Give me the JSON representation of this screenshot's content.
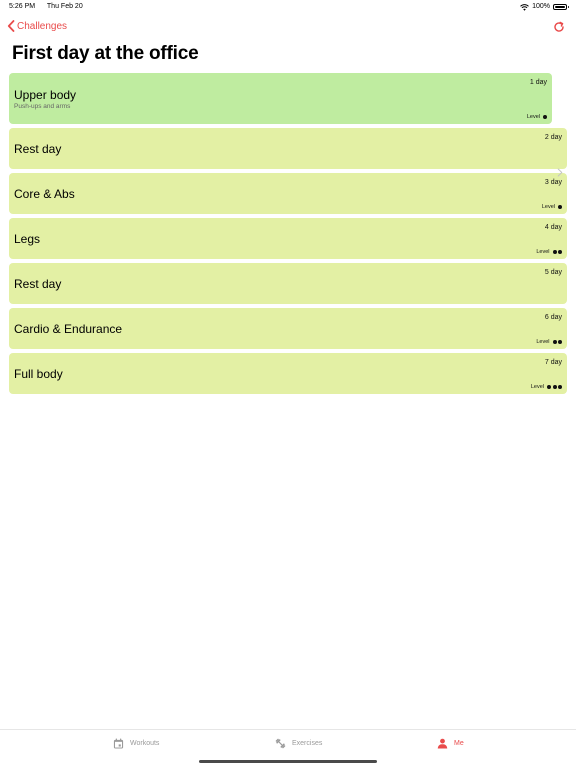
{
  "status_bar": {
    "time": "5:26 PM",
    "date": "Thu Feb 20",
    "battery": "100%"
  },
  "nav": {
    "back_label": "Challenges",
    "accent_color": "#e94b4b"
  },
  "page": {
    "title": "First day at the office"
  },
  "days": [
    {
      "name": "Upper body",
      "subtitle": "Push-ups and arms",
      "day": "1 day",
      "level_label": "Level",
      "level": 1,
      "selected": true
    },
    {
      "name": "Rest day",
      "subtitle": "",
      "day": "2 day",
      "level_label": "",
      "level": 0,
      "selected": false
    },
    {
      "name": "Core & Abs",
      "subtitle": "",
      "day": "3 day",
      "level_label": "Level",
      "level": 1,
      "selected": false
    },
    {
      "name": "Legs",
      "subtitle": "",
      "day": "4 day",
      "level_label": "Level",
      "level": 2,
      "selected": false
    },
    {
      "name": "Rest day",
      "subtitle": "",
      "day": "5 day",
      "level_label": "",
      "level": 0,
      "selected": false
    },
    {
      "name": "Cardio & Endurance",
      "subtitle": "",
      "day": "6 day",
      "level_label": "Level",
      "level": 2,
      "selected": false
    },
    {
      "name": "Full body",
      "subtitle": "",
      "day": "7 day",
      "level_label": "Level",
      "level": 3,
      "selected": false
    }
  ],
  "colors": {
    "selected_row": "#bfeca0",
    "row": "#e3f0a4"
  },
  "tab_bar": {
    "workouts": "Workouts",
    "exercises": "Exercises",
    "me": "Me",
    "active_tab": "me"
  },
  "icons": {
    "back": "chevron-left-icon",
    "refresh": "refresh-icon",
    "row_disclosure": "chevron-right-icon",
    "workouts": "calendar-icon",
    "exercises": "dumbbell-icon",
    "me": "person-icon"
  }
}
